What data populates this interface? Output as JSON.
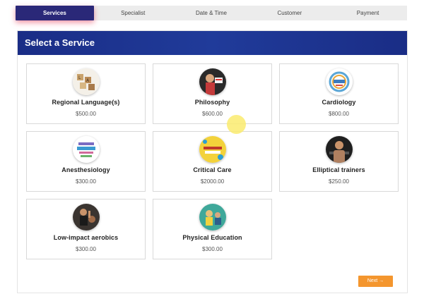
{
  "steps": [
    {
      "label": "Services",
      "active": true
    },
    {
      "label": "Specialist",
      "active": false
    },
    {
      "label": "Date & Time",
      "active": false
    },
    {
      "label": "Customer",
      "active": false
    },
    {
      "label": "Payment",
      "active": false
    }
  ],
  "panel": {
    "title": "Select a Service"
  },
  "services": [
    {
      "name": "Regional Language(s)",
      "price": "$500.00",
      "icon": "language-letters-icon"
    },
    {
      "name": "Philosophy",
      "price": "$600.00",
      "icon": "philosophy-photo-icon"
    },
    {
      "name": "Cardiology",
      "price": "$800.00",
      "icon": "wellness-word-cloud-icon"
    },
    {
      "name": "Anesthesiology",
      "price": "$300.00",
      "icon": "wellness-word-cloud-icon"
    },
    {
      "name": "Critical Care",
      "price": "$2000.00",
      "icon": "healthy-weekend-icon"
    },
    {
      "name": "Elliptical trainers",
      "price": "$250.00",
      "icon": "trainer-photo-icon"
    },
    {
      "name": "Low-impact aerobics",
      "price": "$300.00",
      "icon": "aerobics-photo-icon"
    },
    {
      "name": "Physical Education",
      "price": "$300.00",
      "icon": "education-photo-icon"
    }
  ],
  "next_label": "Next →",
  "colors": {
    "header": "#1f3593",
    "active_step": "#2a2878",
    "next_button": "#f4962e"
  }
}
